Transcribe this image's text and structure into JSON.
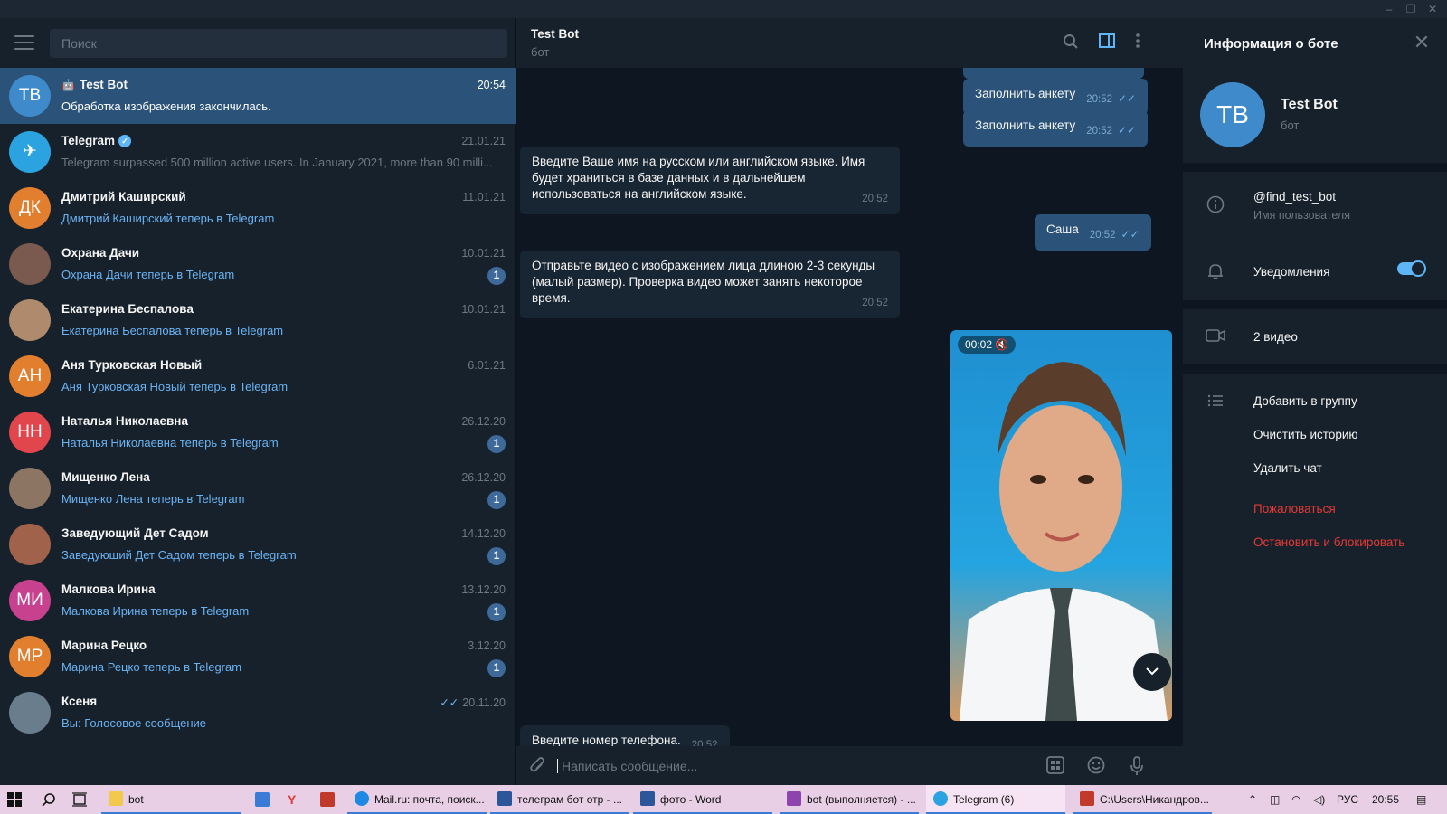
{
  "window": {
    "minimize": "–",
    "maximize": "❐",
    "close": "✕"
  },
  "search": {
    "placeholder": "Поиск"
  },
  "chats": [
    {
      "initials": "TB",
      "color": "#3f8acb",
      "name": "Test Bot",
      "bot_icon": "🤖",
      "date": "20:54",
      "preview": "Обработка изображения закончилась.",
      "active": true
    },
    {
      "initials": "✈",
      "color": "#2aa3e0",
      "name": "Telegram",
      "verified": true,
      "date": "21.01.21",
      "preview": "Telegram surpassed 500 million active users.    In January 2021, more than 90 milli..."
    },
    {
      "initials": "ДК",
      "color": "#e17f2f",
      "name": "Дмитрий Каширский",
      "date": "11.01.21",
      "preview": "Дмитрий Каширский теперь в Telegram"
    },
    {
      "initials": "",
      "color": "#7a5a4e",
      "name": "Охрана Дачи",
      "date": "10.01.21",
      "preview": "Охрана Дачи теперь в Telegram",
      "badge": "1"
    },
    {
      "initials": "",
      "color": "#b08a6c",
      "name": "Екатерина Беспалова",
      "date": "10.01.21",
      "preview": "Екатерина Беспалова теперь в Telegram"
    },
    {
      "initials": "АН",
      "color": "#e17f2f",
      "name": "Аня Турковская Новый",
      "date": "6.01.21",
      "preview": "Аня Турковская Новый теперь в Telegram"
    },
    {
      "initials": "НН",
      "color": "#e0464c",
      "name": "Наталья Николаевна",
      "date": "26.12.20",
      "preview": "Наталья Николаевна теперь в Telegram",
      "badge": "1"
    },
    {
      "initials": "",
      "color": "#8d7564",
      "name": "Мищенко Лена",
      "date": "26.12.20",
      "preview": "Мищенко Лена теперь в Telegram",
      "badge": "1"
    },
    {
      "initials": "",
      "color": "#a0624a",
      "name": "Заведующий Дет Садом",
      "date": "14.12.20",
      "preview": "Заведующий Дет Садом теперь в Telegram",
      "badge": "1"
    },
    {
      "initials": "МИ",
      "color": "#c8418e",
      "name": "Малкова Ирина",
      "date": "13.12.20",
      "preview": "Малкова Ирина теперь в Telegram",
      "badge": "1"
    },
    {
      "initials": "МР",
      "color": "#e17f2f",
      "name": "Марина Рецко",
      "date": "3.12.20",
      "preview": "Марина Рецко теперь в Telegram",
      "badge": "1"
    },
    {
      "initials": "",
      "color": "#6a7d8c",
      "name": "Ксеня",
      "date": "20.11.20",
      "read": "✓✓",
      "preview": "Вы: Голосовое сообщение"
    }
  ],
  "header": {
    "title": "Test Bot",
    "subtitle": "бот"
  },
  "messages": {
    "out1": {
      "text": "Заполнить анкету",
      "time": "20:52",
      "ticks": "✓✓"
    },
    "out2": {
      "text": "Заполнить анкету",
      "time": "20:52",
      "ticks": "✓✓"
    },
    "in1": {
      "text": "Введите Ваше имя на русском или английском языке. Имя будет храниться в базе данных и в дальнейшем использоваться на английском языке.",
      "time": "20:52"
    },
    "out3": {
      "text": "Саша",
      "time": "20:52",
      "ticks": "✓✓"
    },
    "in2": {
      "text": "Отправьте видео с изображением лица длиною 2-3 секунды (малый размер). Проверка видео может занять некоторое время.",
      "time": "20:52"
    },
    "video": {
      "duration": "00:02",
      "mute": "🔇"
    },
    "in3": {
      "text": "Введите номер телефона.",
      "time": "20:52"
    }
  },
  "composer": {
    "placeholder": "Написать сообщение..."
  },
  "info": {
    "title": "Информация о боте",
    "initials": "TB",
    "name": "Test Bot",
    "subtitle": "бот",
    "username": "@find_test_bot",
    "username_label": "Имя пользователя",
    "notifications": "Уведомления",
    "videos": "2 видео",
    "add_to_group": "Добавить в группу",
    "clear_history": "Очистить историю",
    "delete_chat": "Удалить чат",
    "report": "Пожаловаться",
    "block": "Остановить и блокировать"
  },
  "taskbar": {
    "items": [
      {
        "label": "bot",
        "icon_color": "#f2c94c"
      },
      {
        "label": "Mail.ru: почта, поиск...",
        "icon_color": "#1e88e5"
      },
      {
        "label": "телеграм бот отр - ...",
        "icon_color": "#2b579a"
      },
      {
        "label": "фото - Word",
        "icon_color": "#2b579a"
      },
      {
        "label": "bot (выполняется) - ...",
        "icon_color": "#8e44ad"
      },
      {
        "label": "Telegram (6)",
        "icon_color": "#2aa3e0"
      },
      {
        "label": "C:\\Users\\Никандров...",
        "icon_color": "#c0392b"
      }
    ],
    "lang": "РУС",
    "time": "20:55"
  },
  "colors": {
    "accent": "#5eb5f7",
    "active_chat": "#2b5278",
    "danger": "#e53935"
  }
}
